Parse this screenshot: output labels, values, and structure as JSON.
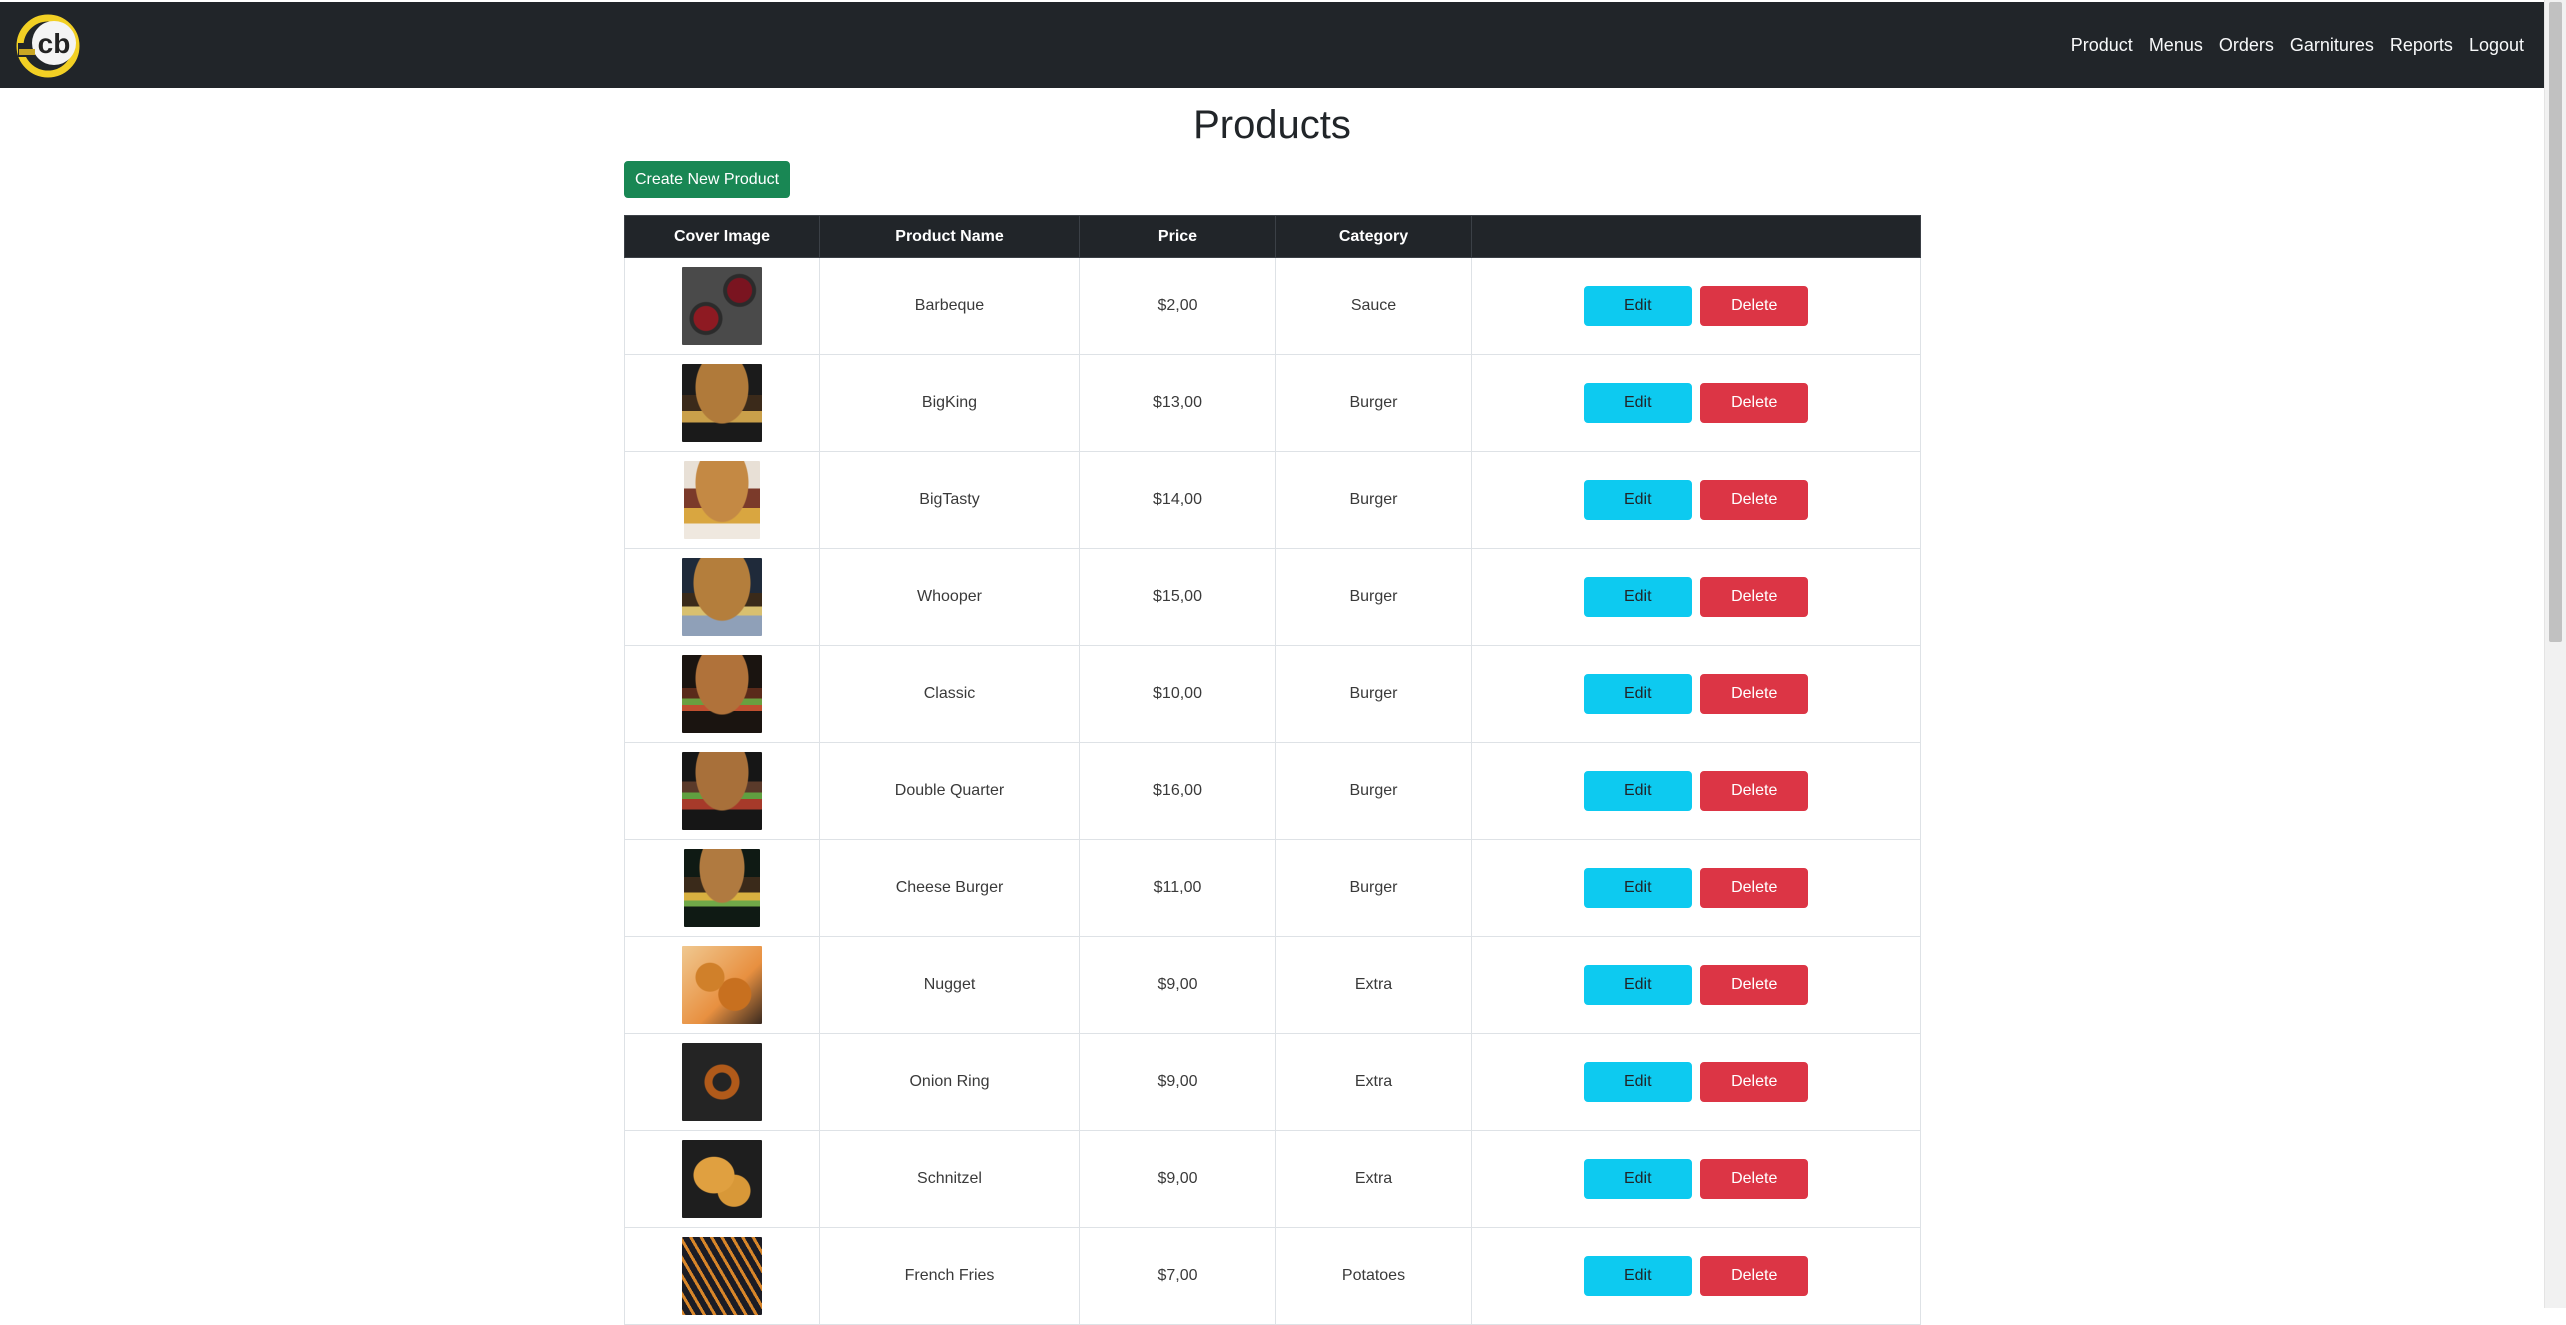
{
  "nav": {
    "logo_text": "cb",
    "links": [
      "Product",
      "Menus",
      "Orders",
      "Garnitures",
      "Reports",
      "Logout"
    ]
  },
  "page": {
    "title": "Products",
    "create_button": "Create New Product"
  },
  "table": {
    "headers": [
      "Cover Image",
      "Product Name",
      "Price",
      "Category",
      ""
    ],
    "edit_label": "Edit",
    "delete_label": "Delete",
    "rows": [
      {
        "name": "Barbeque",
        "price": "$2,00",
        "category": "Sauce",
        "image": "sauce-photo"
      },
      {
        "name": "BigKing",
        "price": "$13,00",
        "category": "Burger",
        "image": "burger-photo"
      },
      {
        "name": "BigTasty",
        "price": "$14,00",
        "category": "Burger",
        "image": "burger-photo"
      },
      {
        "name": "Whooper",
        "price": "$15,00",
        "category": "Burger",
        "image": "burger-photo"
      },
      {
        "name": "Classic",
        "price": "$10,00",
        "category": "Burger",
        "image": "burger-photo"
      },
      {
        "name": "Double Quarter",
        "price": "$16,00",
        "category": "Burger",
        "image": "burger-photo"
      },
      {
        "name": "Cheese Burger",
        "price": "$11,00",
        "category": "Burger",
        "image": "burger-photo"
      },
      {
        "name": "Nugget",
        "price": "$9,00",
        "category": "Extra",
        "image": "nugget-photo"
      },
      {
        "name": "Onion Ring",
        "price": "$9,00",
        "category": "Extra",
        "image": "onion-ring-photo"
      },
      {
        "name": "Schnitzel",
        "price": "$9,00",
        "category": "Extra",
        "image": "schnitzel-photo"
      },
      {
        "name": "French Fries",
        "price": "$7,00",
        "category": "Potatoes",
        "image": "fries-photo"
      }
    ]
  },
  "colors": {
    "navbar": "#212529",
    "success": "#198754",
    "info": "#0dcaf0",
    "danger": "#dc3545"
  }
}
